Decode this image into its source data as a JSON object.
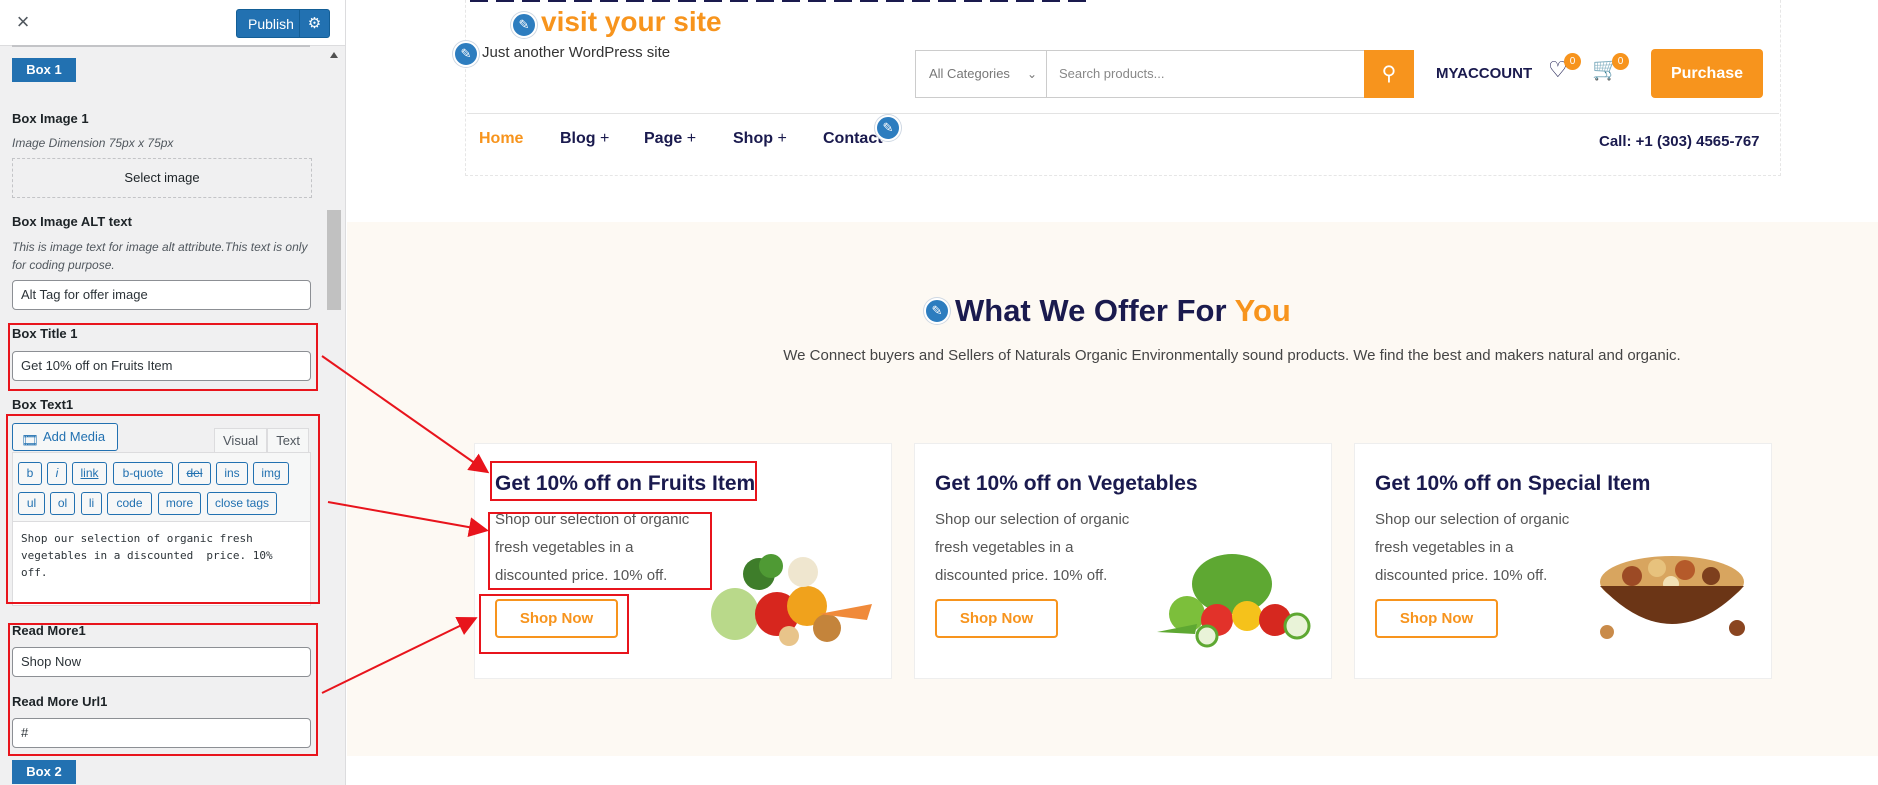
{
  "sidebar": {
    "close_icon": "×",
    "publish_label": "Publish",
    "box1_badge": "Box 1",
    "box_image_label": "Box Image 1",
    "box_image_desc": "Image Dimension 75px x 75px",
    "select_image_label": "Select image",
    "alt_label": "Box Image ALT text",
    "alt_desc": "This is image text for image alt attribute.This text is only for coding purpose.",
    "alt_value": "Alt Tag for offer image",
    "title_label": "Box Title 1",
    "title_value": "Get 10% off on Fruits Item",
    "text_label": "Box Text1",
    "add_media_label": "Add Media",
    "tab_visual": "Visual",
    "tab_text": "Text",
    "quicktags": [
      "b",
      "i",
      "link",
      "b-quote",
      "del",
      "ins",
      "img",
      "ul",
      "ol",
      "li",
      "code",
      "more",
      "close tags"
    ],
    "editor_content": "Shop our selection of organic fresh vegetables in a discounted  price. 10% off.",
    "readmore_label": "Read More1",
    "readmore_value": "Shop Now",
    "readmore_url_label": "Read More Url1",
    "readmore_url_value": "#",
    "box2_badge": "Box 2"
  },
  "preview": {
    "site_title": "visit your site",
    "tagline": "Just another WordPress site",
    "category_select": "All Categories",
    "search_placeholder": "Search products...",
    "myaccount": "MYACCOUNT",
    "wishlist_count": "0",
    "cart_count": "0",
    "purchase_label": "Purchase",
    "nav": [
      "Home",
      "Blog",
      "Page",
      "Shop",
      "Contact"
    ],
    "plus": "+",
    "call": "Call: +1 (303) 4565-767",
    "offer_title_main": "What We Offer For",
    "offer_title_accent": "You",
    "offer_desc": "We Connect buyers and Sellers of Naturals Organic Environmentally sound products. We find the best and makers natural and organic.",
    "cards": [
      {
        "title": "Get 10% off on Fruits Item",
        "text": "Shop our selection of organic fresh vegetables in a discounted price. 10% off.",
        "button": "Shop Now"
      },
      {
        "title": "Get 10% off on Vegetables",
        "text": "Shop our selection of organic fresh vegetables in a discounted price. 10% off.",
        "button": "Shop Now"
      },
      {
        "title": "Get 10% off on Special Item",
        "text": "Shop our selection of organic fresh vegetables in a discounted price. 10% off.",
        "button": "Shop Now"
      }
    ]
  },
  "colors": {
    "accent": "#f7941d",
    "navy": "#1a1a4e",
    "wp_blue": "#2271b1",
    "annotation_red": "#e8141c"
  }
}
